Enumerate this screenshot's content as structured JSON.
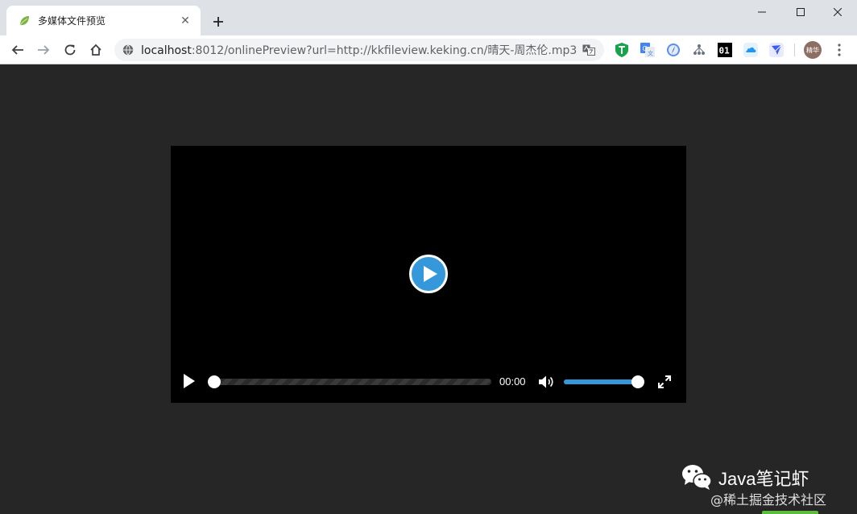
{
  "browser": {
    "tab_title": "多媒体文件预览",
    "tab_close": "✕",
    "url_host": "localhost",
    "url_rest": ":8012/onlinePreview?url=http://kkfileview.keking.cn/晴天-周杰伦.mp3",
    "profile_label": "精华",
    "extensions": [
      "adguard-icon",
      "google-translate-icon",
      "safari-like-icon",
      "network-icon",
      "binary-01-icon",
      "cloud-icon",
      "feather-icon"
    ],
    "ext_01_label": "01"
  },
  "player": {
    "current_time": "00:00",
    "progress": 0,
    "volume": 1.0,
    "accent_color": "#3498db"
  },
  "watermark": {
    "title": "Java笔记虾",
    "subtitle": "@稀土掘金技术社区"
  }
}
